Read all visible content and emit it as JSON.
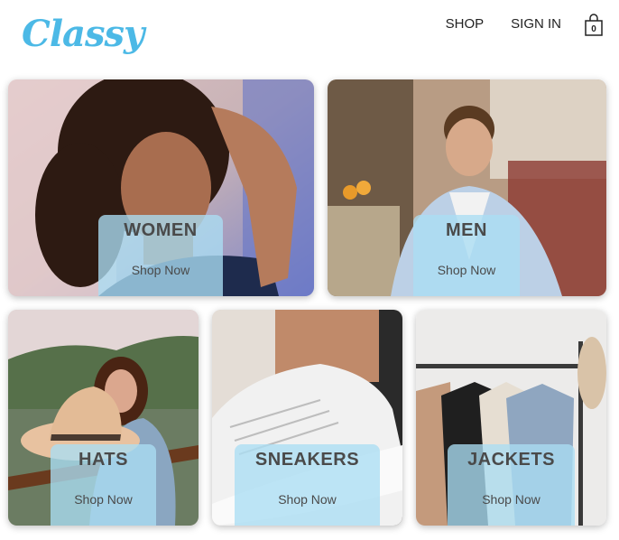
{
  "header": {
    "logo": "Classy",
    "nav": {
      "shop": "SHOP",
      "sign_in": "SIGN IN"
    },
    "cart_count": "0"
  },
  "tiles": [
    {
      "title": "WOMEN",
      "cta": "Shop Now"
    },
    {
      "title": "MEN",
      "cta": "Shop Now"
    },
    {
      "title": "HATS",
      "cta": "Shop Now"
    },
    {
      "title": "SNEAKERS",
      "cta": "Shop Now"
    },
    {
      "title": "JACKETS",
      "cta": "Shop Now"
    }
  ],
  "colors": {
    "brand": "#4cb9e6",
    "overlay": "#aadef4",
    "text": "#4a4a4a"
  },
  "icons": {
    "cart": "shopping-bag-icon"
  }
}
